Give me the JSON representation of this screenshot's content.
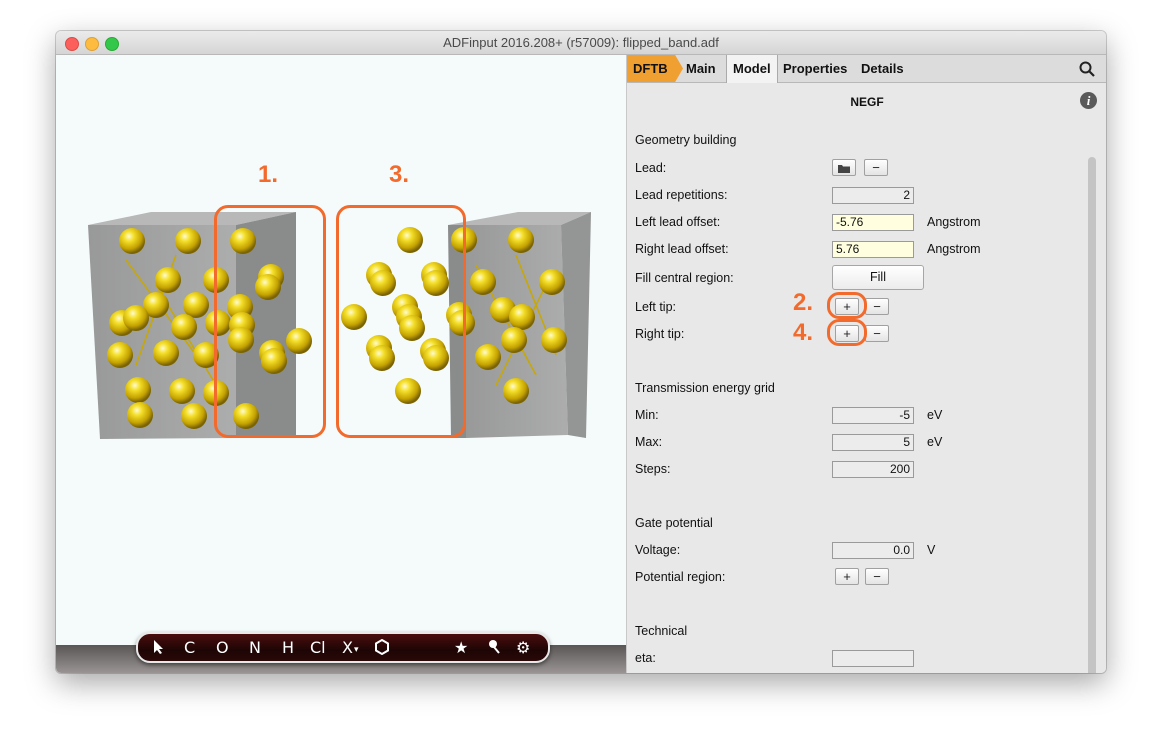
{
  "window": {
    "title": "ADFinput 2016.208+ (r57009): flipped_band.adf"
  },
  "tabs": [
    {
      "label": "DFTB"
    },
    {
      "label": "Main"
    },
    {
      "label": "Model"
    },
    {
      "label": "Properties"
    },
    {
      "label": "Details"
    }
  ],
  "panel": {
    "title": "NEGF",
    "geometry": {
      "heading": "Geometry building",
      "lead_label": "Lead:",
      "lead_repetitions_label": "Lead repetitions:",
      "lead_repetitions_value": "2",
      "left_offset_label": "Left lead offset:",
      "left_offset_value": "-5.76",
      "left_offset_unit": "Angstrom",
      "right_offset_label": "Right lead offset:",
      "right_offset_value": "5.76",
      "right_offset_unit": "Angstrom",
      "fill_label": "Fill central region:",
      "fill_button": "Fill",
      "left_tip_label": "Left tip:",
      "right_tip_label": "Right tip:"
    },
    "transmission": {
      "heading": "Transmission energy grid",
      "min_label": "Min:",
      "min_value": "-5",
      "min_unit": "eV",
      "max_label": "Max:",
      "max_value": "5",
      "max_unit": "eV",
      "steps_label": "Steps:",
      "steps_value": "200"
    },
    "gate": {
      "heading": "Gate potential",
      "voltage_label": "Voltage:",
      "voltage_value": "0.0",
      "voltage_unit": "V",
      "region_label": "Potential region:"
    },
    "technical": {
      "heading": "Technical",
      "eta_label": "eta:",
      "eta_value": ""
    }
  },
  "buttons": {
    "plus": "+",
    "minus": "−"
  },
  "toolbar": {
    "items": [
      "C",
      "O",
      "N",
      "H",
      "Cl",
      "X",
      "★",
      "⚙"
    ]
  },
  "annotations": [
    "1.",
    "2.",
    "3.",
    "4."
  ],
  "colors": {
    "annotation": "#f26b2c",
    "dftb_tab": "#f0a030",
    "atom": "#e8c400"
  }
}
